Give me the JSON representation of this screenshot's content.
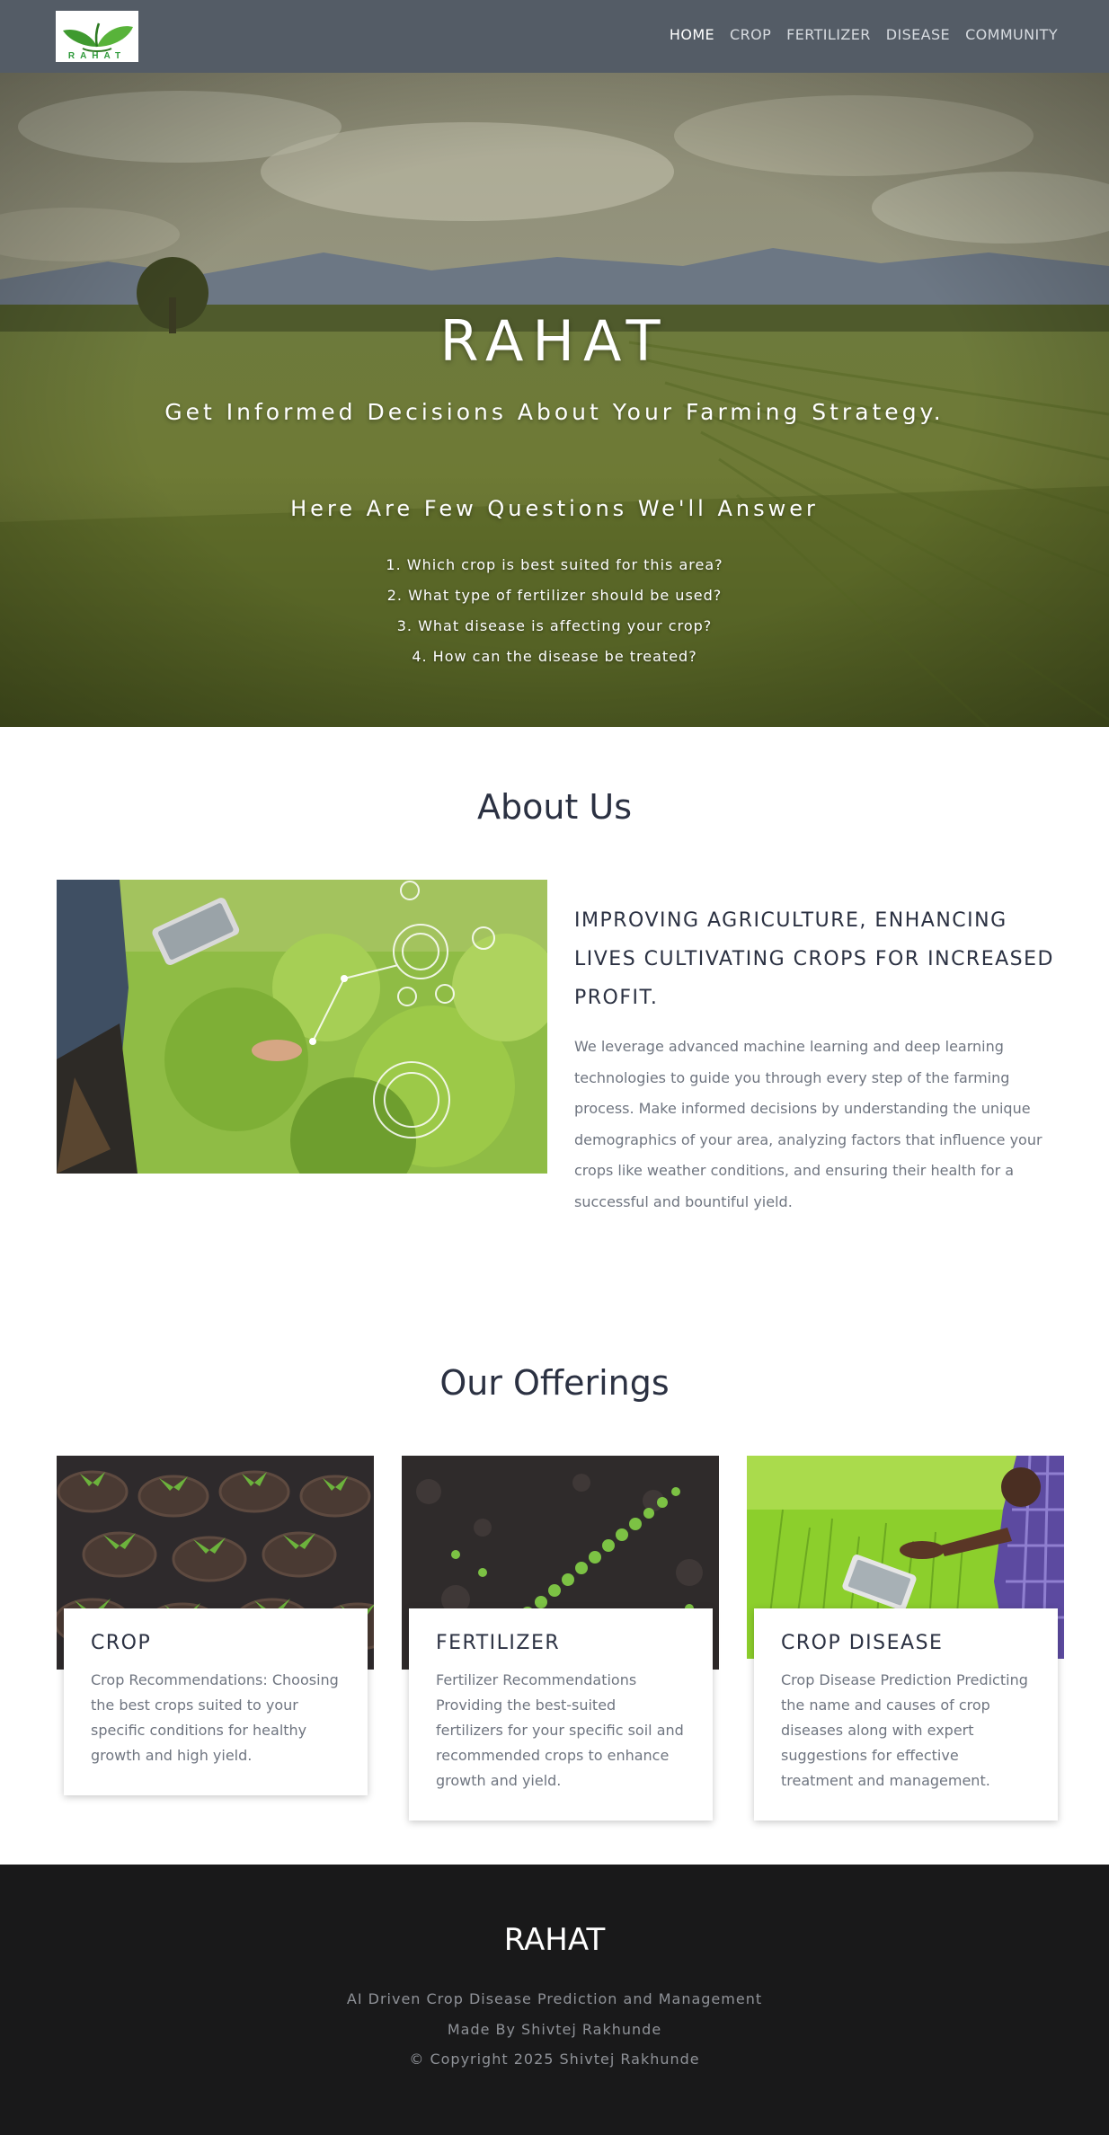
{
  "nav": {
    "logo_text": "RAHAT",
    "links": [
      {
        "label": "HOME",
        "active": true
      },
      {
        "label": "CROP",
        "active": false
      },
      {
        "label": "FERTILIZER",
        "active": false
      },
      {
        "label": "DISEASE",
        "active": false
      },
      {
        "label": "COMMUNITY",
        "active": false
      }
    ]
  },
  "hero": {
    "title": "RAHAT",
    "subtitle": "Get Informed Decisions About Your Farming Strategy.",
    "questions_heading": "Here Are Few Questions We'll Answer",
    "questions": [
      "1. Which crop is best suited for this area?",
      "2. What type of fertilizer should be used?",
      "3. What disease is affecting your crop?",
      "4. How can the disease be treated?"
    ]
  },
  "about": {
    "title": "About Us",
    "heading": "IMPROVING AGRICULTURE, ENHANCING LIVES CULTIVATING CROPS FOR INCREASED PROFIT.",
    "paragraph": "We leverage advanced machine learning and deep learning technologies to guide you through every step of the farming process. Make informed decisions by understanding the unique demographics of your area, analyzing factors that influence your crops like weather conditions, and ensuring their health for a successful and bountiful yield."
  },
  "offerings": {
    "title": "Our Offerings",
    "cards": [
      {
        "title": "CROP",
        "description": "Crop Recommendations: Choosing the best crops suited to your specific conditions for healthy growth and high yield."
      },
      {
        "title": "FERTILIZER",
        "description": "Fertilizer Recommendations Providing the best-suited fertilizers for your specific soil and recommended crops to enhance growth and yield."
      },
      {
        "title": "CROP DISEASE",
        "description": "Crop Disease Prediction Predicting the name and causes of crop diseases along with expert suggestions for effective treatment and management."
      }
    ]
  },
  "footer": {
    "title": "RAHAT",
    "tagline": "AI Driven Crop Disease Prediction and Management",
    "made_by": "Made By Shivtej Rakhunde",
    "copyright": "© Copyright 2025 Shivtej Rakhunde"
  },
  "colors": {
    "nav_bg": "#545c66",
    "footer_bg": "#19191a",
    "heading": "#2b3142",
    "body_text": "#6f7580"
  }
}
